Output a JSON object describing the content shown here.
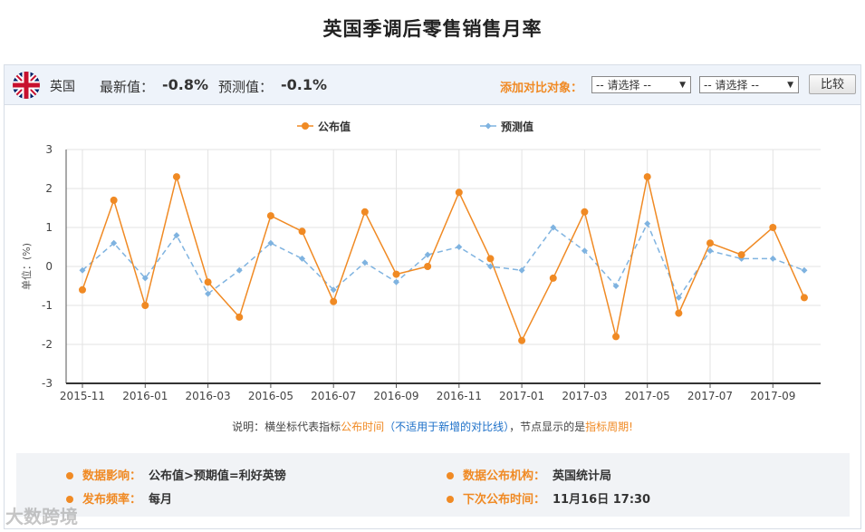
{
  "page": {
    "title": "英国季调后零售销售月率"
  },
  "header": {
    "country": "英国",
    "latest_label": "最新值：",
    "latest_value": "-0.8%",
    "forecast_label": "预测值：",
    "forecast_value": "-0.1%",
    "compare_label": "添加对比对象：",
    "select1": "-- 请选择 --",
    "select2": "-- 请选择 --",
    "compare_button": "比较"
  },
  "note": {
    "part1": "说明：横坐标代表指标",
    "part2": "公布时间",
    "part3": "（不适用于新增的对比线）",
    "part4": "，节点显示的是",
    "part5": "指标周期!"
  },
  "info": {
    "impact_label": "数据影响：",
    "impact_value": "公布值>预期值=利好英镑",
    "agency_label": "数据公布机构：",
    "agency_value": "英国统计局",
    "freq_label": "发布频率：",
    "freq_value": "每月",
    "next_label": "下次公布时间：",
    "next_value": "11月16日 17:30"
  },
  "watermark": "大数跨境",
  "colors": {
    "actual": "#f08a24",
    "forecast": "#7fb3e0",
    "accent": "#f08a24"
  },
  "chart_data": {
    "type": "line",
    "title": "",
    "xlabel": "",
    "ylabel": "单位：(%)",
    "ylim": [
      -3,
      3
    ],
    "yticks": [
      3,
      2,
      1,
      0,
      -1,
      -2,
      -3
    ],
    "xtick_labels": [
      "2015-11",
      "2016-01",
      "2016-03",
      "2016-05",
      "2016-07",
      "2016-09",
      "2016-11",
      "2017-01",
      "2017-03",
      "2017-05",
      "2017-07",
      "2017-09"
    ],
    "x": [
      "2015-11",
      "2015-12",
      "2016-01",
      "2016-02",
      "2016-03",
      "2016-04",
      "2016-05",
      "2016-06",
      "2016-07",
      "2016-08",
      "2016-09",
      "2016-10",
      "2016-11",
      "2016-12",
      "2017-01",
      "2017-02",
      "2017-03",
      "2017-04",
      "2017-05",
      "2017-06",
      "2017-07",
      "2017-08",
      "2017-09",
      "2017-10"
    ],
    "legend": "top-center",
    "grid": true,
    "series": [
      {
        "name": "公布值",
        "values": [
          -0.6,
          1.7,
          -1.0,
          2.3,
          -0.4,
          -1.3,
          1.3,
          0.9,
          -0.9,
          1.4,
          -0.2,
          0.0,
          1.9,
          0.2,
          -1.9,
          -0.3,
          1.4,
          -1.8,
          2.3,
          -1.2,
          0.6,
          0.3,
          1.0,
          -0.8
        ]
      },
      {
        "name": "预测值",
        "values": [
          -0.1,
          0.6,
          -0.3,
          0.8,
          -0.7,
          -0.1,
          0.6,
          0.2,
          -0.6,
          0.1,
          -0.4,
          0.3,
          0.5,
          0.0,
          -0.1,
          1.0,
          0.4,
          -0.5,
          1.1,
          -0.8,
          0.4,
          0.2,
          0.2,
          -0.1
        ]
      }
    ]
  }
}
